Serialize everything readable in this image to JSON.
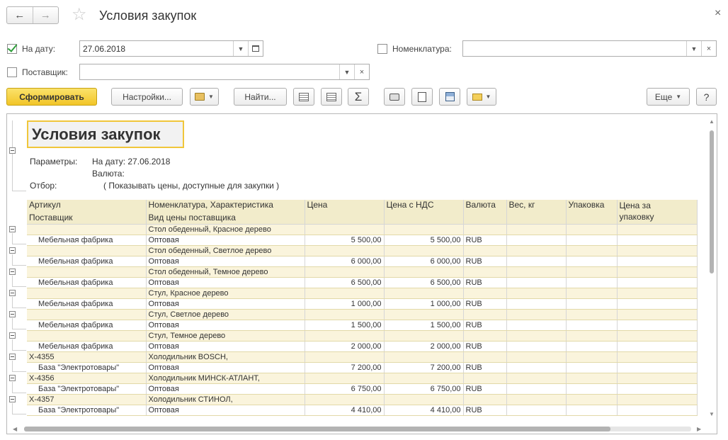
{
  "window": {
    "title": "Условия закупок",
    "close": "×"
  },
  "filters": {
    "date": {
      "label": "На дату:",
      "checked": true,
      "value": "27.06.2018"
    },
    "nomenclature": {
      "label": "Номенклатура:",
      "checked": false,
      "value": ""
    },
    "supplier": {
      "label": "Поставщик:",
      "checked": false,
      "value": ""
    }
  },
  "toolbar": {
    "generate": "Сформировать",
    "settings": "Настройки...",
    "find": "Найти...",
    "sum": "Σ",
    "more": "Еще",
    "help": "?"
  },
  "report": {
    "title": "Условия закупок",
    "params_label": "Параметры:",
    "param_date": "На дату: 27.06.2018",
    "param_currency": "Валюта:",
    "filter_label": "Отбор:",
    "filter_value": "( Показывать цены, доступные для закупки )",
    "headers": {
      "article": "Артикул",
      "supplier": "Поставщик",
      "nomenclature": "Номенклатура, Характеристика",
      "price_kind": "Вид цены поставщика",
      "price": "Цена",
      "price_vat": "Цена с НДС",
      "currency": "Валюта",
      "weight": "Вес, кг",
      "package": "Упаковка",
      "price_pack_1": "Цена за",
      "price_pack_2": "упаковку"
    },
    "groups": [
      {
        "article": "",
        "item": "Стол обеденный, Красное дерево",
        "supplier": "Мебельная фабрика",
        "kind": "Оптовая",
        "price": "5 500,00",
        "price_vat": "5 500,00",
        "currency": "RUB"
      },
      {
        "article": "",
        "item": "Стол обеденный, Светлое дерево",
        "supplier": "Мебельная фабрика",
        "kind": "Оптовая",
        "price": "6 000,00",
        "price_vat": "6 000,00",
        "currency": "RUB"
      },
      {
        "article": "",
        "item": "Стол обеденный, Темное дерево",
        "supplier": "Мебельная фабрика",
        "kind": "Оптовая",
        "price": "6 500,00",
        "price_vat": "6 500,00",
        "currency": "RUB"
      },
      {
        "article": "",
        "item": "Стул, Красное дерево",
        "supplier": "Мебельная фабрика",
        "kind": "Оптовая",
        "price": "1 000,00",
        "price_vat": "1 000,00",
        "currency": "RUB"
      },
      {
        "article": "",
        "item": "Стул, Светлое дерево",
        "supplier": "Мебельная фабрика",
        "kind": "Оптовая",
        "price": "1 500,00",
        "price_vat": "1 500,00",
        "currency": "RUB"
      },
      {
        "article": "",
        "item": "Стул, Темное дерево",
        "supplier": "Мебельная фабрика",
        "kind": "Оптовая",
        "price": "2 000,00",
        "price_vat": "2 000,00",
        "currency": "RUB"
      },
      {
        "article": "Х-4355",
        "item": "Холодильник BOSCH,",
        "supplier": "База \"Электротовары\"",
        "kind": "Оптовая",
        "price": "7 200,00",
        "price_vat": "7 200,00",
        "currency": "RUB"
      },
      {
        "article": "Х-4356",
        "item": "Холодильник МИНСК-АТЛАНТ,",
        "supplier": "База \"Электротовары\"",
        "kind": "Оптовая",
        "price": "6 750,00",
        "price_vat": "6 750,00",
        "currency": "RUB"
      },
      {
        "article": "Х-4357",
        "item": "Холодильник СТИНОЛ,",
        "supplier": "База \"Электротовары\"",
        "kind": "Оптовая",
        "price": "4 410,00",
        "price_vat": "4 410,00",
        "currency": "RUB"
      }
    ]
  }
}
